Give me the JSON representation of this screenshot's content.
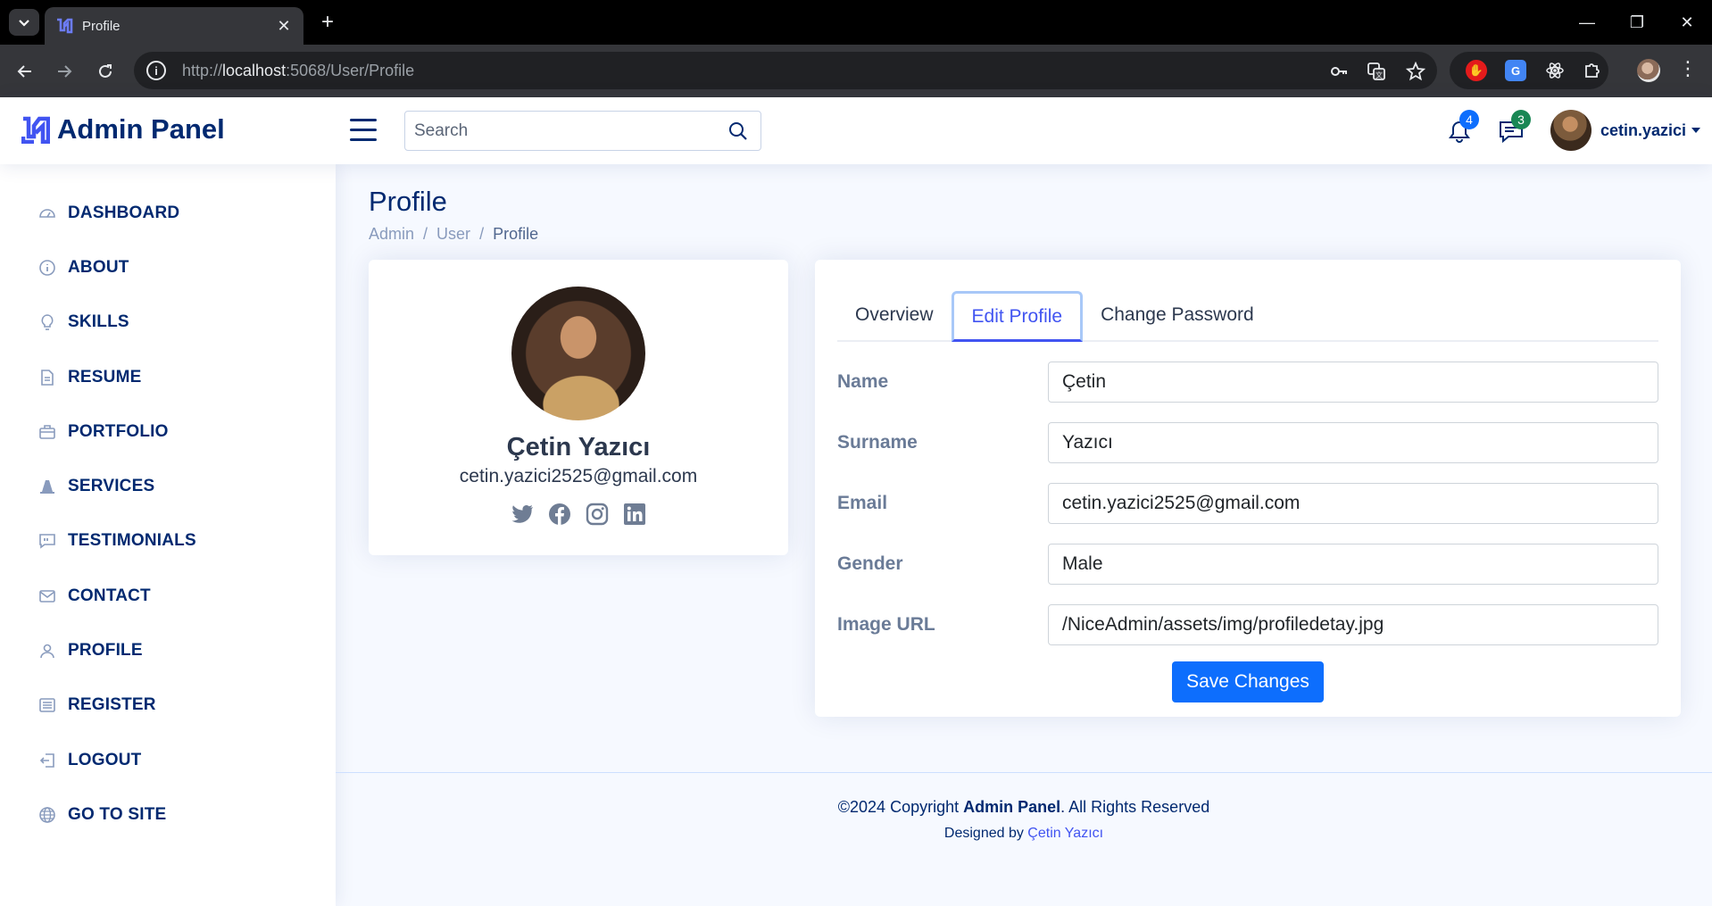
{
  "browser": {
    "tab_title": "Profile",
    "url_scheme": "http://",
    "url_host": "localhost",
    "url_path": ":5068/User/Profile",
    "accent_color": "#35363a"
  },
  "header": {
    "brand": "Admin Panel",
    "search_placeholder": "Search",
    "notifications_count": "4",
    "messages_count": "3",
    "user_name": "cetin.yazici"
  },
  "sidebar": {
    "items": [
      {
        "label": "DASHBOARD",
        "icon": "grid-icon"
      },
      {
        "label": "ABOUT",
        "icon": "info-icon"
      },
      {
        "label": "SKILLS",
        "icon": "lightbulb-icon"
      },
      {
        "label": "RESUME",
        "icon": "file-icon"
      },
      {
        "label": "PORTFOLIO",
        "icon": "briefcase-icon"
      },
      {
        "label": "SERVICES",
        "icon": "cone-icon"
      },
      {
        "label": "TESTIMONIALS",
        "icon": "quote-icon"
      },
      {
        "label": "CONTACT",
        "icon": "envelope-icon"
      },
      {
        "label": "PROFILE",
        "icon": "person-icon"
      },
      {
        "label": "REGISTER",
        "icon": "card-list-icon"
      },
      {
        "label": "LOGOUT",
        "icon": "box-arrow-left-icon"
      },
      {
        "label": "GO TO SITE",
        "icon": "globe-icon"
      }
    ]
  },
  "page": {
    "title": "Profile",
    "breadcrumb": [
      "Admin",
      "User",
      "Profile"
    ]
  },
  "profile": {
    "name": "Çetin Yazıcı",
    "email": "cetin.yazici2525@gmail.com",
    "social": [
      "twitter-icon",
      "facebook-icon",
      "instagram-icon",
      "linkedin-icon"
    ]
  },
  "tabs": [
    {
      "label": "Overview",
      "active": false
    },
    {
      "label": "Edit Profile",
      "active": true
    },
    {
      "label": "Change Password",
      "active": false
    }
  ],
  "form": {
    "fields": [
      {
        "label": "Name",
        "value": "Çetin"
      },
      {
        "label": "Surname",
        "value": "Yazıcı"
      },
      {
        "label": "Email",
        "value": "cetin.yazici2525@gmail.com"
      },
      {
        "label": "Gender",
        "value": "Male"
      },
      {
        "label": "Image URL",
        "value": "/NiceAdmin/assets/img/profiledetay.jpg"
      }
    ],
    "save_label": "Save Changes"
  },
  "footer": {
    "copyright_prefix": "©2024 Copyright ",
    "copyright_brand": "Admin Panel",
    "copyright_suffix": ". All Rights Reserved",
    "designed_by": "Designed by ",
    "designer": "Çetin Yazıcı"
  },
  "colors": {
    "primary": "#012970",
    "accent": "#4154f1",
    "button": "#0d6efd",
    "badge_blue": "#0d6efd",
    "badge_green": "#198754"
  }
}
